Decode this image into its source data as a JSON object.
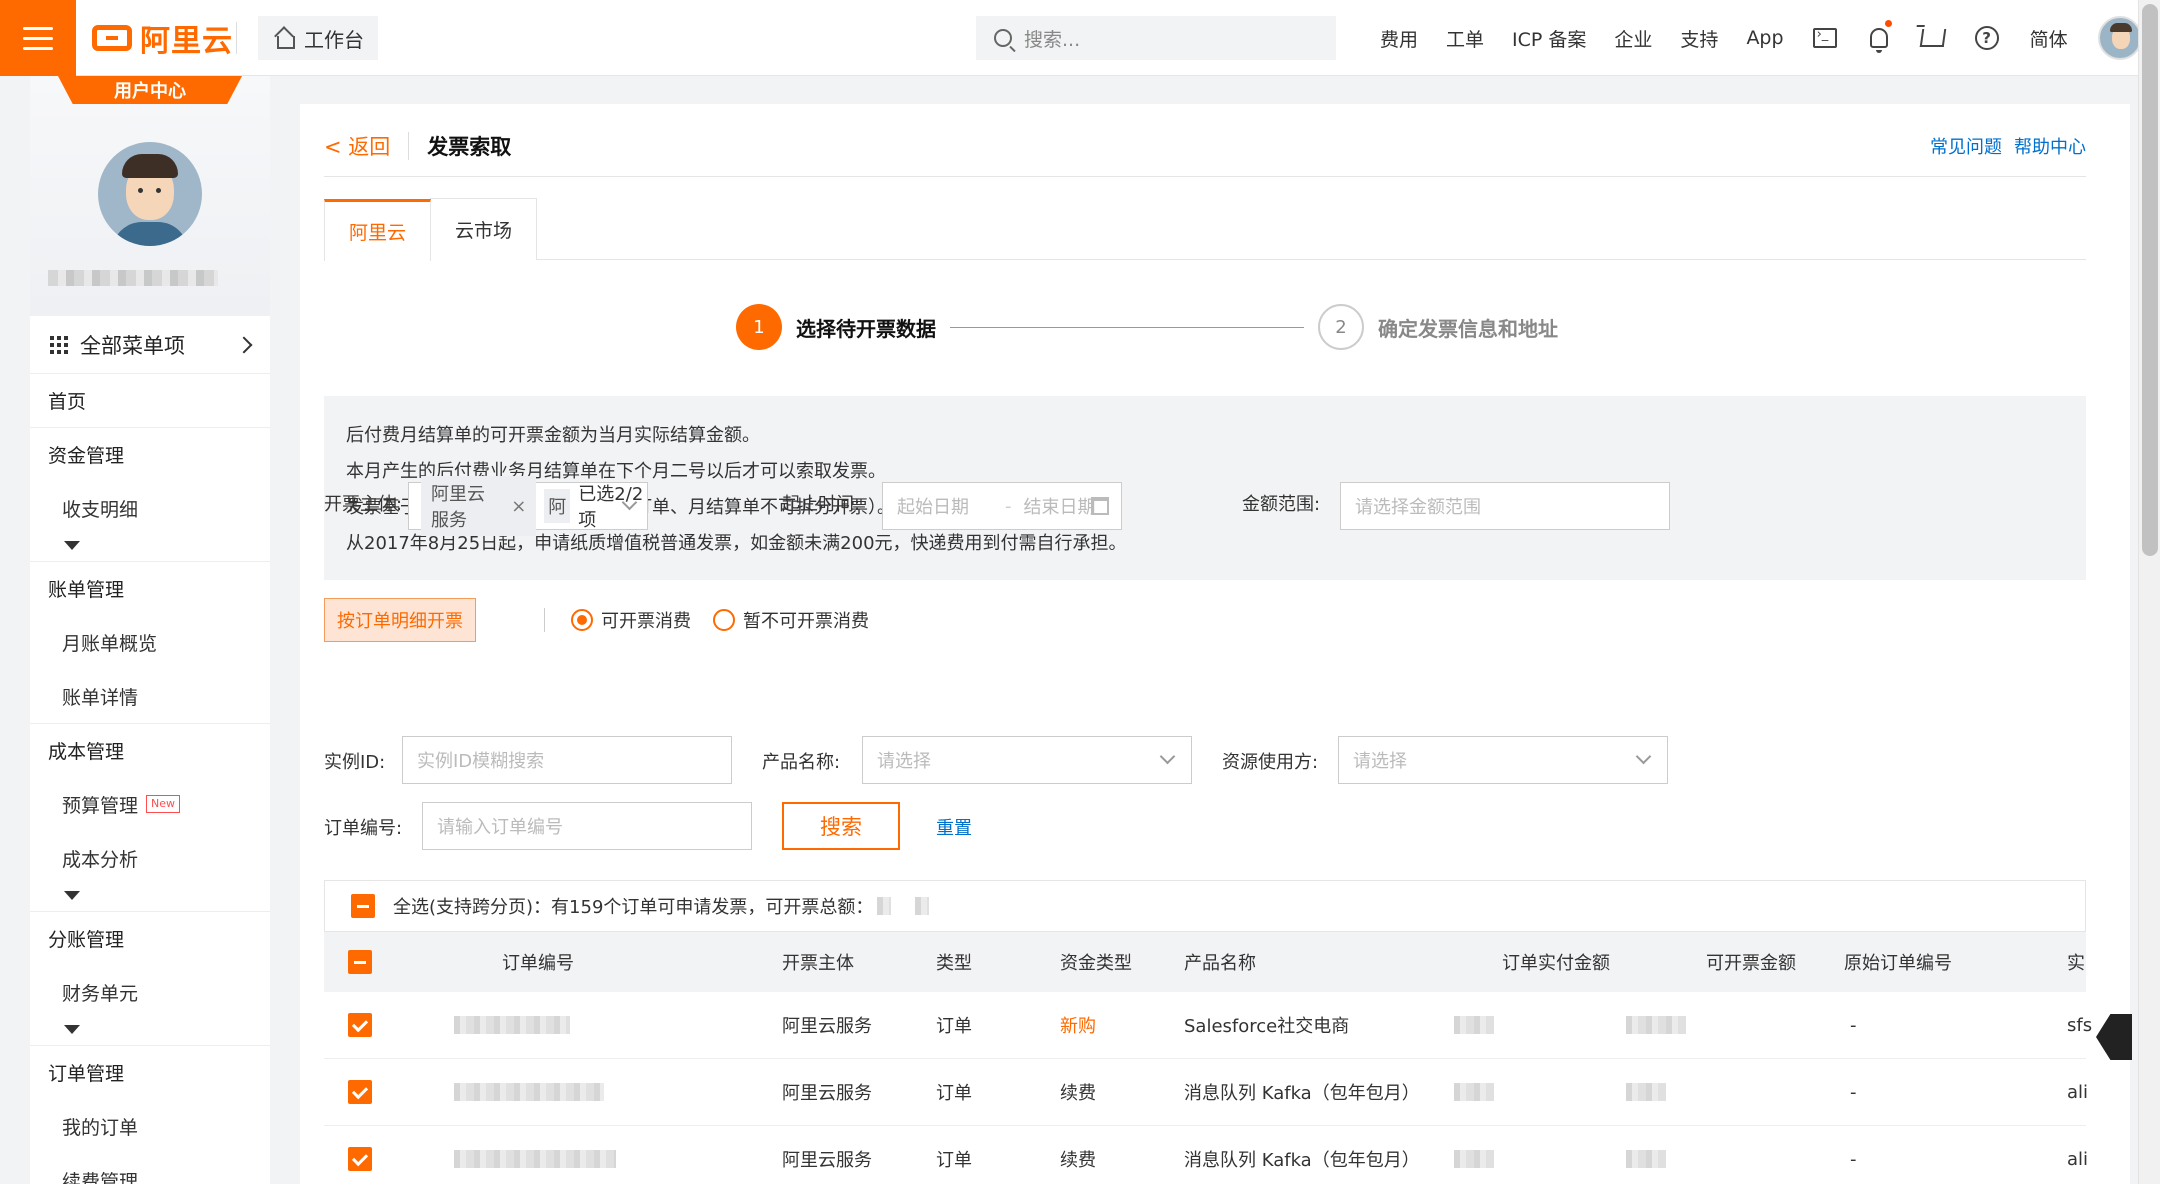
{
  "topbar": {
    "logo_text": "阿里云",
    "workbench_label": "工作台",
    "search_placeholder": "搜索...",
    "nav_links": [
      "费用",
      "工单",
      "ICP 备案",
      "企业",
      "支持",
      "App"
    ],
    "lang_label": "简体",
    "icons": [
      "terminal-icon",
      "bell-icon",
      "cart-icon",
      "help-icon"
    ],
    "accent_color": "#ff6a00"
  },
  "sidebar": {
    "badge": "用户中心",
    "all_menu_label": "全部菜单项",
    "groups": [
      {
        "title": "首页",
        "items": [],
        "more": false
      },
      {
        "title": "资金管理",
        "items": [
          {
            "label": "收支明细"
          }
        ],
        "more": true
      },
      {
        "title": "账单管理",
        "items": [
          {
            "label": "月账单概览"
          },
          {
            "label": "账单详情"
          }
        ],
        "more": false
      },
      {
        "title": "成本管理",
        "items": [
          {
            "label": "预算管理",
            "badge": "New"
          },
          {
            "label": "成本分析"
          }
        ],
        "more": true
      },
      {
        "title": "分账管理",
        "items": [
          {
            "label": "财务单元"
          }
        ],
        "more": true
      },
      {
        "title": "订单管理",
        "items": [
          {
            "label": "我的订单"
          },
          {
            "label": "续费管理"
          }
        ],
        "more": false
      }
    ]
  },
  "header": {
    "back_label": "< 返回",
    "title": "发票索取",
    "links": [
      "常见问题",
      "帮助中心"
    ]
  },
  "tabs": [
    {
      "label": "阿里云",
      "active": true
    },
    {
      "label": "云市场",
      "active": false
    }
  ],
  "steps": [
    {
      "num": "1",
      "label": "选择待开票数据",
      "active": true
    },
    {
      "num": "2",
      "label": "确定发票信息和地址",
      "active": false
    }
  ],
  "notice": [
    "后付费月结算单的可开票金额为当月实际结算金额。",
    "本月产生的后付费业务月结算单在下个月二号以后才可以索取发票。",
    "发票基于订单、月结算单开具（单个订单、月结算单不可拆分开票）。",
    "从2017年8月25日起，申请纸质增值税普通发票，如金额未满200元，快递费用到付需自行承担。"
  ],
  "filters": {
    "detail_button": "按订单明细开票",
    "radio_invoiceable": "可开票消费",
    "radio_not_invoiceable": "暂不可开票消费",
    "entity_label": "开票主体:",
    "entity_tag": "阿里云服务",
    "entity_tag2": "阿",
    "entity_selected": "已选2/2项",
    "time_label": "起止时间:",
    "start_placeholder": "起始日期",
    "end_placeholder": "结束日期",
    "amount_label": "金额范围:",
    "amount_placeholder": "请选择金额范围",
    "instance_label": "实例ID:",
    "instance_placeholder": "实例ID模糊搜索",
    "product_label": "产品名称:",
    "product_placeholder": "请选择",
    "resource_label": "资源使用方:",
    "resource_placeholder": "请选择",
    "order_label": "订单编号:",
    "order_placeholder": "请输入订单编号",
    "search_button": "搜索",
    "reset_link": "重置"
  },
  "select_all_text": "全选(支持跨分页)：有159个订单可申请发票，可开票总额：",
  "table": {
    "columns": [
      "订单编号",
      "开票主体",
      "类型",
      "资金类型",
      "产品名称",
      "订单实付金额",
      "可开票金额",
      "原始订单编号",
      "实"
    ],
    "rows": [
      {
        "entity": "阿里云服务",
        "type": "订单",
        "fund": "新购",
        "product": "Salesforce社交电商",
        "original": "-",
        "last": "sfs"
      },
      {
        "entity": "阿里云服务",
        "type": "订单",
        "fund": "续费",
        "product": "消息队列 Kafka（包年包月）",
        "original": "-",
        "last": "ali"
      },
      {
        "entity": "阿里云服务",
        "type": "订单",
        "fund": "续费",
        "product": "消息队列 Kafka（包年包月）",
        "original": "-",
        "last": "ali"
      }
    ]
  }
}
